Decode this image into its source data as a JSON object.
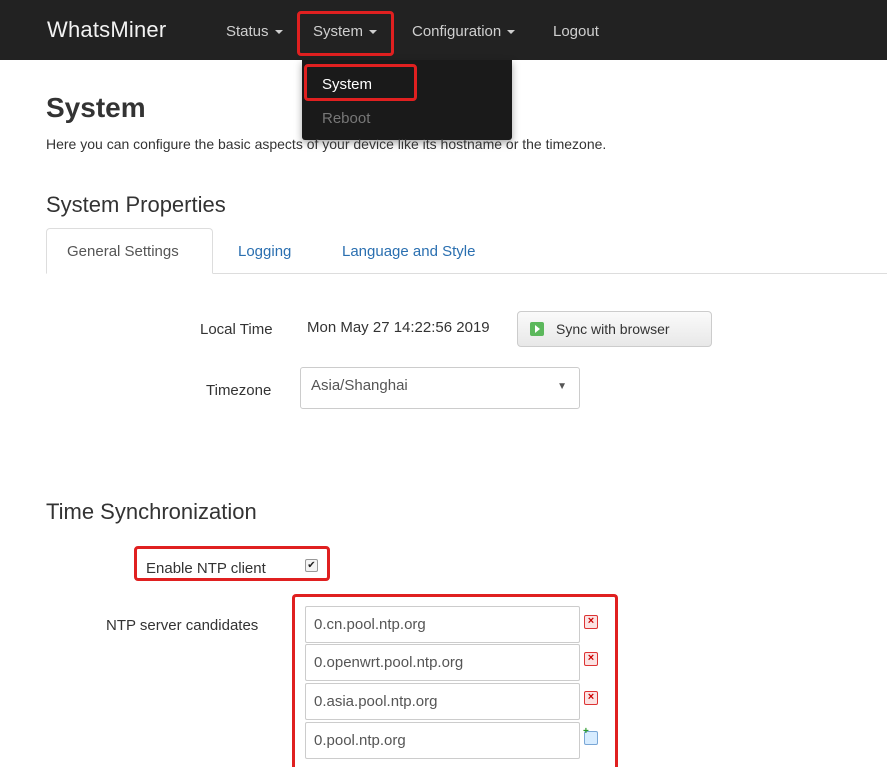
{
  "navbar": {
    "brand": "WhatsMiner",
    "items": [
      {
        "label": "Status",
        "has_caret": true
      },
      {
        "label": "System",
        "has_caret": true,
        "highlighted": true
      },
      {
        "label": "Configuration",
        "has_caret": true
      },
      {
        "label": "Logout",
        "has_caret": false
      }
    ]
  },
  "dropdown": {
    "items": [
      {
        "label": "System",
        "active": true
      },
      {
        "label": "Reboot",
        "active": false
      }
    ]
  },
  "page": {
    "title": "System",
    "description": "Here you can configure the basic aspects of your device like its hostname or the timezone."
  },
  "properties": {
    "title": "System Properties",
    "tabs": [
      {
        "label": "General Settings",
        "active": true
      },
      {
        "label": "Logging",
        "active": false
      },
      {
        "label": "Language and Style",
        "active": false
      }
    ],
    "local_time_label": "Local Time",
    "local_time_value": "Mon May 27 14:22:56 2019",
    "sync_button": "Sync with browser",
    "timezone_label": "Timezone",
    "timezone_value": "Asia/Shanghai"
  },
  "time_sync": {
    "title": "Time Synchronization",
    "ntp_client_label": "Enable NTP client",
    "ntp_client_enabled": true,
    "ntp_client_check": "✔",
    "ntp_servers_label": "NTP server candidates",
    "ntp_servers": [
      "0.cn.pool.ntp.org",
      "0.openwrt.pool.ntp.org",
      "0.asia.pool.ntp.org",
      "0.pool.ntp.org"
    ],
    "remove_glyph": "×"
  },
  "colors": {
    "navbar_bg": "#222222",
    "highlight": "#e02020",
    "link": "#2a6fb0",
    "dropdown_bg": "#1a1a1a"
  },
  "icons": {
    "sync": "sync-play-icon",
    "remove": "remove-entry-icon",
    "add": "add-entry-icon"
  }
}
